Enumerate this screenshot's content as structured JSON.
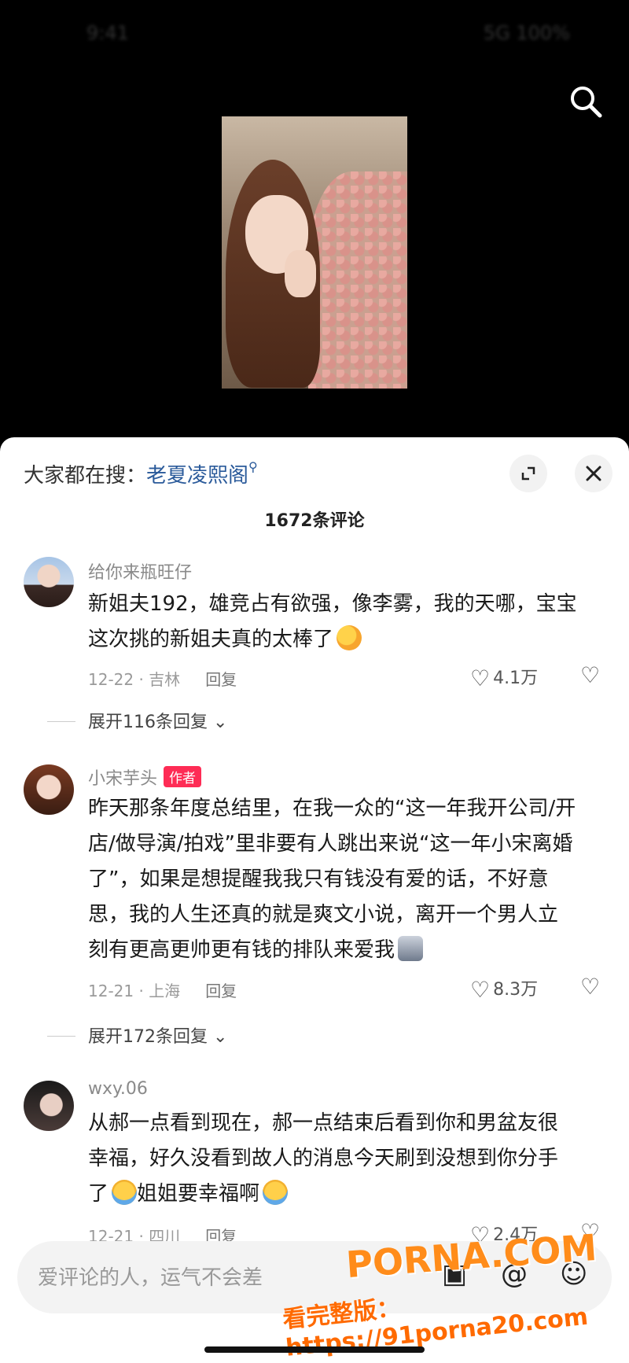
{
  "status_bar": {
    "time": "9:41",
    "indicators": "5G 100%"
  },
  "top": {
    "search_icon": "search-icon"
  },
  "sheet": {
    "hot_search_label": "大家都在搜：",
    "hot_search_keyword": "老夏凌熙阁",
    "expand_icon": "expand-icon",
    "close_icon": "close-icon",
    "comment_count": "1672条评论"
  },
  "comments": [
    {
      "username": "给你来瓶旺仔",
      "lines": [
        "新姐夫192，雄竞占有欲强，像李雾，我的天哪，宝宝",
        "这次挑的新姐夫真的太棒了"
      ],
      "meta": "12-22 · 吉林",
      "reply_label": "回复",
      "likes": "4.1万",
      "more_replies": "展开116条回复"
    },
    {
      "username": "小宋芋头",
      "badge": "作者",
      "lines": [
        "昨天那条年度总结里，在我一众的“这一年我开公司/开",
        "店/做导演/拍戏”里非要有人跳出来说“这一年小宋离婚",
        "了”，如果是想提醒我我只有钱没有爱的话，不好意",
        "思，我的人生还真的就是爽文小说，离开一个男人立",
        "刻有更高更帅更有钱的排队来爱我"
      ],
      "meta": "12-21 · 上海",
      "reply_label": "回复",
      "likes": "8.3万",
      "more_replies": "展开172条回复"
    },
    {
      "username": "wxy.06",
      "lines": [
        "从郝一点看到现在，郝一点结束后看到你和男盆友很",
        "幸福，好久没看到故人的消息今天刷到没想到你分手",
        "了",
        "姐姐要幸福啊"
      ],
      "meta": "12-21 · 四川",
      "reply_label": "回复",
      "likes": "2.4万"
    }
  ],
  "input": {
    "placeholder": "爱评论的人，运气不会差"
  },
  "watermark": {
    "logo": "PORNA.COM",
    "url": "看完整版：https://91porna20.com"
  }
}
